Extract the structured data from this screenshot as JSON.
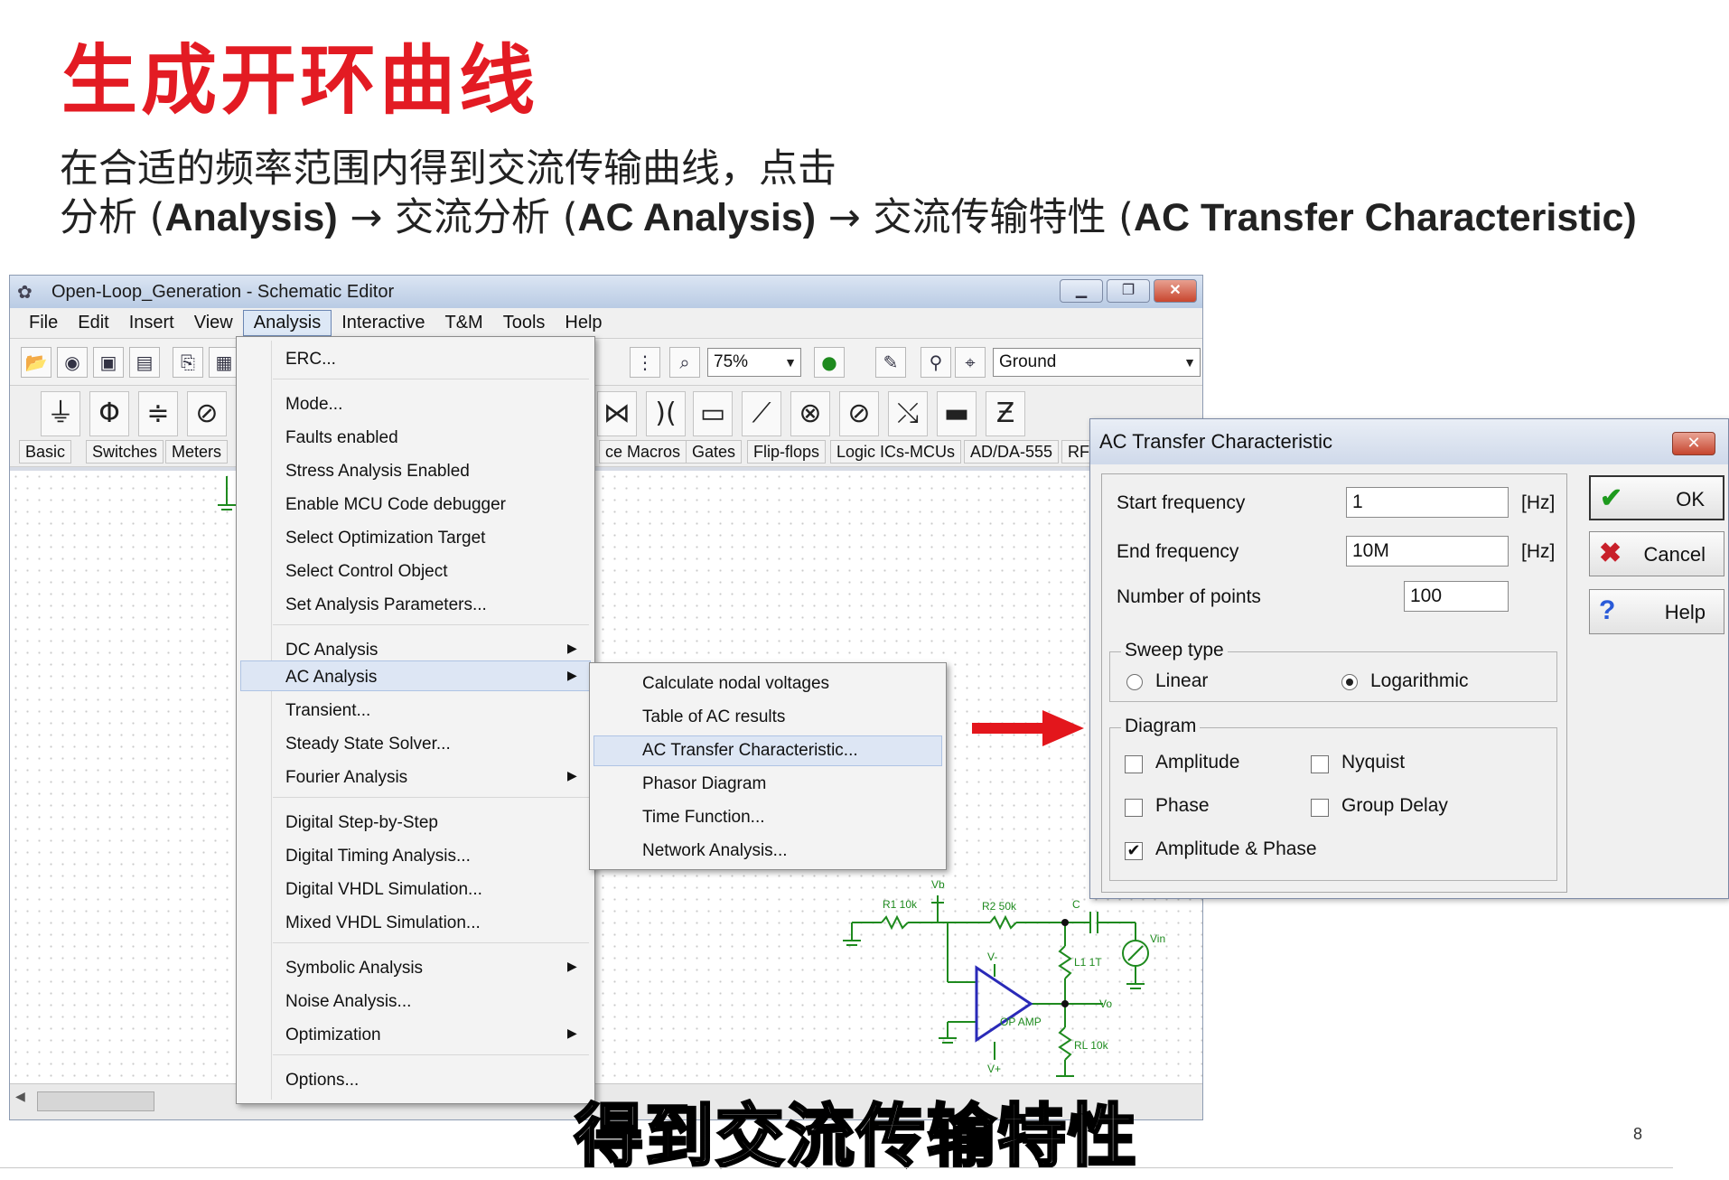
{
  "slide": {
    "title": "生成开环曲线",
    "line1": "在合适的频率范围内得到交流传输曲线，点击",
    "line2_a": "分析 (",
    "line2_b": "Analysis)",
    "line2_c": " → 交流分析 (",
    "line2_d": "AC Analysis)",
    "line2_e": " → 交流传输特性 (",
    "line2_f": "AC Transfer Characteristic)",
    "caption": "得到交流传输特性",
    "page_number": "8"
  },
  "window": {
    "title": "Open-Loop_Generation - Schematic Editor",
    "menu": [
      "File",
      "Edit",
      "Insert",
      "View",
      "Analysis",
      "Interactive",
      "T&M",
      "Tools",
      "Help"
    ],
    "zoom": "75%",
    "ground_combo": "Ground",
    "component_tabs": [
      "Basic",
      "Switches",
      "Meters",
      "ce Macros",
      "Gates",
      "Flip-flops",
      "Logic ICs-MCUs",
      "AD/DA-555",
      "RF"
    ]
  },
  "analysis_menu": {
    "items": [
      "ERC...",
      "Mode...",
      "Faults enabled",
      "Stress Analysis Enabled",
      "Enable MCU Code debugger",
      "Select Optimization Target",
      "Select Control Object",
      "Set Analysis Parameters...",
      "DC Analysis",
      "AC Analysis",
      "Transient...",
      "Steady State Solver...",
      "Fourier Analysis",
      "Digital Step-by-Step",
      "Digital Timing Analysis...",
      "Digital VHDL Simulation...",
      "Mixed VHDL Simulation...",
      "Symbolic Analysis",
      "Noise Analysis...",
      "Optimization",
      "Options..."
    ]
  },
  "ac_submenu": {
    "items": [
      "Calculate nodal voltages",
      "Table of AC results",
      "AC Transfer Characteristic...",
      "Phasor Diagram",
      "Time Function...",
      "Network Analysis..."
    ]
  },
  "dialog": {
    "title": "AC Transfer Characteristic",
    "start_frequency_label": "Start frequency",
    "start_frequency_value": "1",
    "end_frequency_label": "End frequency",
    "end_frequency_value": "10M",
    "unit": "[Hz]",
    "points_label": "Number of points",
    "points_value": "100",
    "sweep_title": "Sweep type",
    "sweep_linear": "Linear",
    "sweep_log": "Logarithmic",
    "diagram_title": "Diagram",
    "amplitude": "Amplitude",
    "nyquist": "Nyquist",
    "phase": "Phase",
    "group_delay": "Group Delay",
    "amp_phase": "Amplitude & Phase",
    "ok": "OK",
    "cancel": "Cancel",
    "help": "Help"
  },
  "schematic": {
    "labels": [
      "Vb",
      "R1 10k",
      "R2 50k",
      "C",
      "Vin",
      "V-",
      "L1 1T",
      "Vo",
      "OP AMP",
      "RL 10k",
      "V+"
    ]
  },
  "colors": {
    "title_red": "#e31b23",
    "arrow_red": "#e3161c",
    "opamp_blue": "#2a2ab8",
    "resistor_green": "#1e8a1e"
  }
}
